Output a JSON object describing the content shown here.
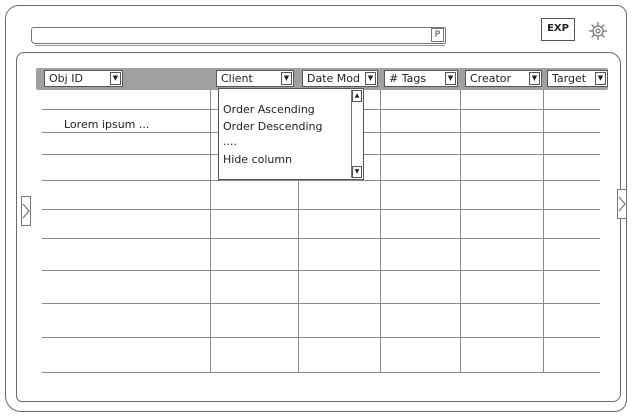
{
  "toolbar": {
    "search_value": "",
    "search_button_label": "P",
    "export_label": "EXP",
    "settings_icon": "gear-icon"
  },
  "table": {
    "columns": [
      {
        "label": "Obj ID"
      },
      {
        "label": "Client"
      },
      {
        "label": "Date Mod"
      },
      {
        "label": "# Tags"
      },
      {
        "label": "Creator"
      },
      {
        "label": "Target"
      }
    ],
    "rows": [
      [
        "Lorem ipsum ...",
        "",
        "",
        "",
        "",
        ""
      ]
    ]
  },
  "column_menu": {
    "items": [
      {
        "label": "Order Ascending"
      },
      {
        "label": "Order Descending"
      },
      {
        "label": "...."
      },
      {
        "label": "Hide column"
      }
    ]
  },
  "nav": {
    "prev_icon": "left-arrow-icon",
    "next_icon": "right-arrow-icon"
  }
}
